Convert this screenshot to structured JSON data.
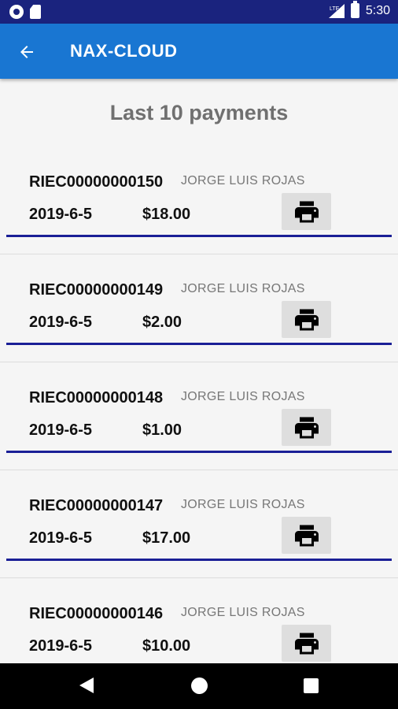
{
  "status_bar": {
    "time": "5:30",
    "network_label": "LTE"
  },
  "app_bar": {
    "title": "NAX-CLOUD"
  },
  "section": {
    "title": "Last 10 payments"
  },
  "payments": [
    {
      "code": "RIEC00000000150",
      "name": "JORGE LUIS ROJAS",
      "date": "2019-6-5",
      "amount": "$18.00"
    },
    {
      "code": "RIEC00000000149",
      "name": "JORGE LUIS ROJAS",
      "date": "2019-6-5",
      "amount": "$2.00"
    },
    {
      "code": "RIEC00000000148",
      "name": "JORGE LUIS ROJAS",
      "date": "2019-6-5",
      "amount": "$1.00"
    },
    {
      "code": "RIEC00000000147",
      "name": "JORGE LUIS ROJAS",
      "date": "2019-6-5",
      "amount": "$17.00"
    },
    {
      "code": "RIEC00000000146",
      "name": "JORGE LUIS ROJAS",
      "date": "2019-6-5",
      "amount": "$10.00"
    }
  ],
  "colors": {
    "status_bar": "#1a237e",
    "app_bar": "#1976d2",
    "divider": "#1a1f96"
  }
}
